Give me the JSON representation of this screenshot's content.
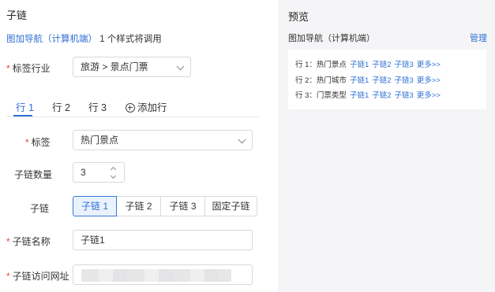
{
  "editor": {
    "title": "子链",
    "subtitle_link": "图加导航（计算机端）",
    "subtitle_rest": "1 个样式将调用",
    "industry": {
      "label": "标签行业",
      "value": "旅游 > 景点门票"
    },
    "tabs": [
      "行 1",
      "行 2",
      "行 3"
    ],
    "add_row_label": "添加行",
    "tag": {
      "label": "标签",
      "value": "热门景点"
    },
    "count": {
      "label": "子链数量",
      "value": "3"
    },
    "sublink": {
      "label": "子链",
      "options": [
        "子链 1",
        "子链 2",
        "子链 3",
        "固定子链"
      ],
      "selected_index": 0
    },
    "name": {
      "label": "子链名称",
      "value": "子链1"
    },
    "url": {
      "label": "子链访问网址"
    }
  },
  "preview": {
    "title": "预览",
    "subtitle": "图加导航（计算机端）",
    "manage_label": "管理",
    "rows": [
      {
        "prefix": "行 1：热门景点",
        "links": [
          "子链1",
          "子链2",
          "子链3",
          "更多>>"
        ]
      },
      {
        "prefix": "行 2：热门城市",
        "links": [
          "子链1",
          "子链2",
          "子链3",
          "更多>>"
        ]
      },
      {
        "prefix": "行 3：门票类型",
        "links": [
          "子链1",
          "子链2",
          "子链3",
          "更多>>"
        ]
      }
    ]
  },
  "colors": {
    "accent": "#2f6fd6",
    "required": "#e6453c",
    "preview_bg": "#f5f5f7"
  }
}
